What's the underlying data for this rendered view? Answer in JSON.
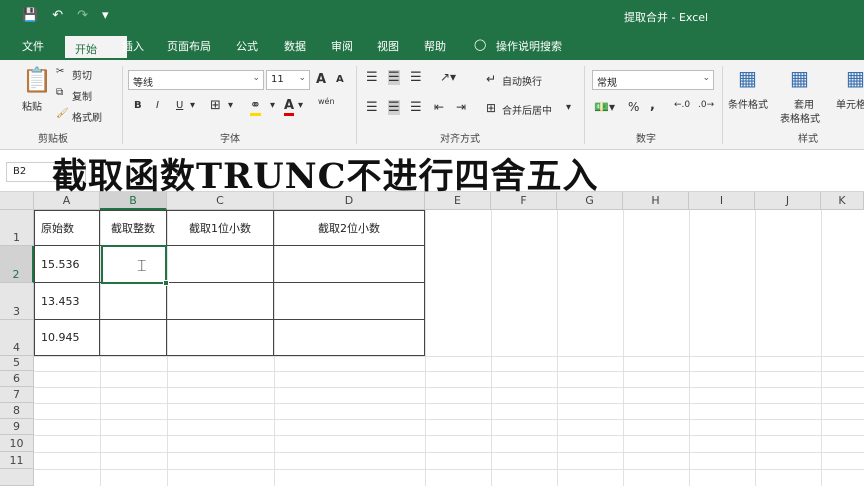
{
  "title_bar": {
    "window_title": "提取合并 - Excel",
    "save_icon": "save-icon",
    "undo_icon": "undo-icon",
    "redo_icon": "redo-icon",
    "customize_icon": "customize-qat-icon"
  },
  "tabs": [
    {
      "label": "文件"
    },
    {
      "label": "开始",
      "active": true
    },
    {
      "label": "插入"
    },
    {
      "label": "页面布局"
    },
    {
      "label": "公式"
    },
    {
      "label": "数据"
    },
    {
      "label": "审阅"
    },
    {
      "label": "视图"
    },
    {
      "label": "帮助"
    },
    {
      "label": "操作说明搜索"
    }
  ],
  "ribbon": {
    "clipboard": {
      "paste": "粘贴",
      "cut": "剪切",
      "copy": "复制",
      "format_painter": "格式刷",
      "group": "剪贴板"
    },
    "font": {
      "name": "等线",
      "size": "11",
      "bold": "B",
      "italic": "I",
      "underline": "U",
      "grow": "A",
      "shrink": "A",
      "font_color": "A",
      "phonetic": "wén",
      "group": "字体"
    },
    "alignment": {
      "wrap": "自动换行",
      "merge": "合并后居中",
      "group": "对齐方式"
    },
    "number": {
      "format": "常规",
      "percent": "%",
      "comma": ",",
      "group": "数字"
    },
    "styles": {
      "conditional": "条件格式",
      "table_format_line1": "套用",
      "table_format_line2": "表格格式",
      "cell_styles": "单元格",
      "group": "样式"
    }
  },
  "formula_bar": {
    "name_box": "B2"
  },
  "overlay_caption": "截取函数TRUNC不进行四舍五入",
  "grid": {
    "columns": [
      "A",
      "B",
      "C",
      "D",
      "E",
      "F",
      "G",
      "H",
      "I",
      "J",
      "K"
    ],
    "rows": [
      "1",
      "2",
      "3",
      "4",
      "5",
      "6",
      "7",
      "8",
      "9",
      "10",
      "11"
    ],
    "header_row": [
      "原始数",
      "截取整数",
      "截取1位小数",
      "截取2位小数"
    ],
    "values": [
      "15.536",
      "13.453",
      "10.945"
    ],
    "selected_cell": "B2"
  },
  "colors": {
    "accent": "#217346",
    "ribbon_bg": "#f3f3f3",
    "grid_line": "#e1e1e1"
  }
}
